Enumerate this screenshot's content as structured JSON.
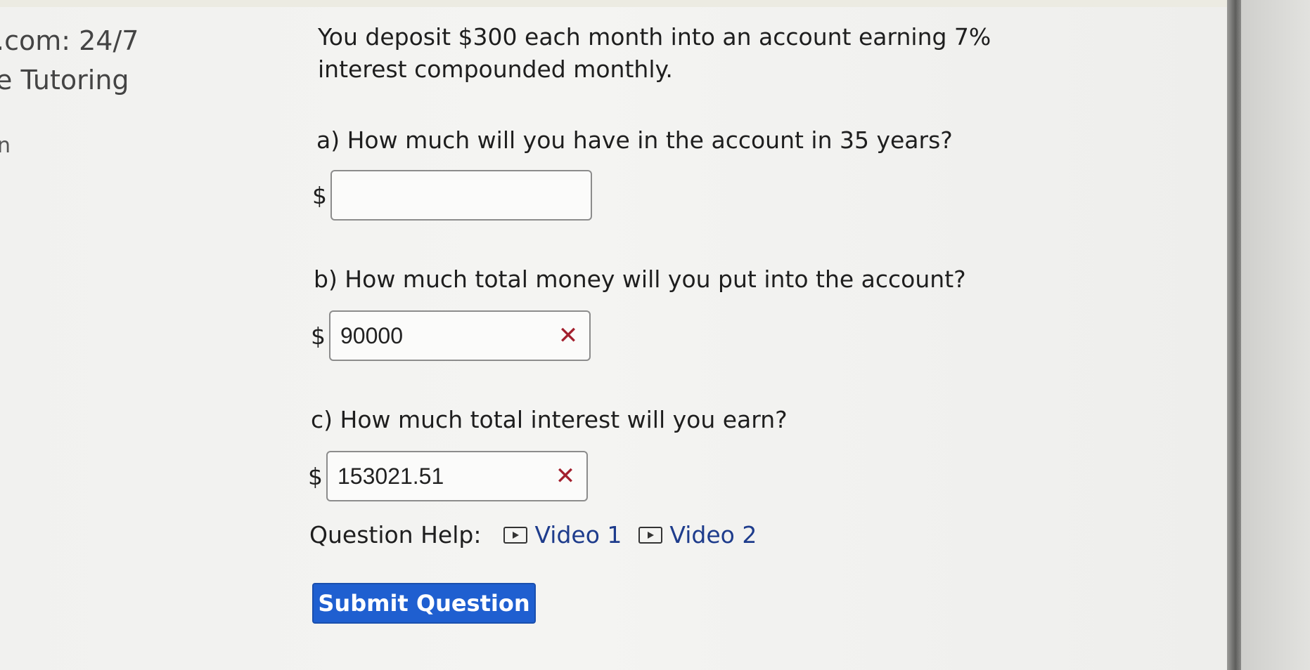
{
  "sidebar": {
    "line1": ".com: 24/7",
    "line2": "e Tutoring",
    "line3": "n"
  },
  "question": {
    "text": "You deposit $300 each month into an account earning 7% interest compounded monthly."
  },
  "parts": [
    {
      "label": "a) How much will you have in the account in 35 years?",
      "currency": "$",
      "value": "",
      "status": "unanswered"
    },
    {
      "label": "b) How much total money will you put into the account?",
      "currency": "$",
      "value": "90000",
      "status": "incorrect",
      "status_icon": "x-mark-icon"
    },
    {
      "label": "c) How much total interest will you earn?",
      "currency": "$",
      "value": "153021.51",
      "status": "incorrect",
      "status_icon": "x-mark-icon"
    }
  ],
  "help": {
    "label": "Question Help:",
    "videos": [
      {
        "label": "Video 1",
        "icon": "play-icon"
      },
      {
        "label": "Video 2",
        "icon": "play-icon"
      }
    ]
  },
  "submit": {
    "label": "Submit Question",
    "color": "#1f5fd0"
  },
  "status_colors": {
    "incorrect": "#a3202e"
  },
  "glyphs": {
    "x_mark": "✕"
  }
}
